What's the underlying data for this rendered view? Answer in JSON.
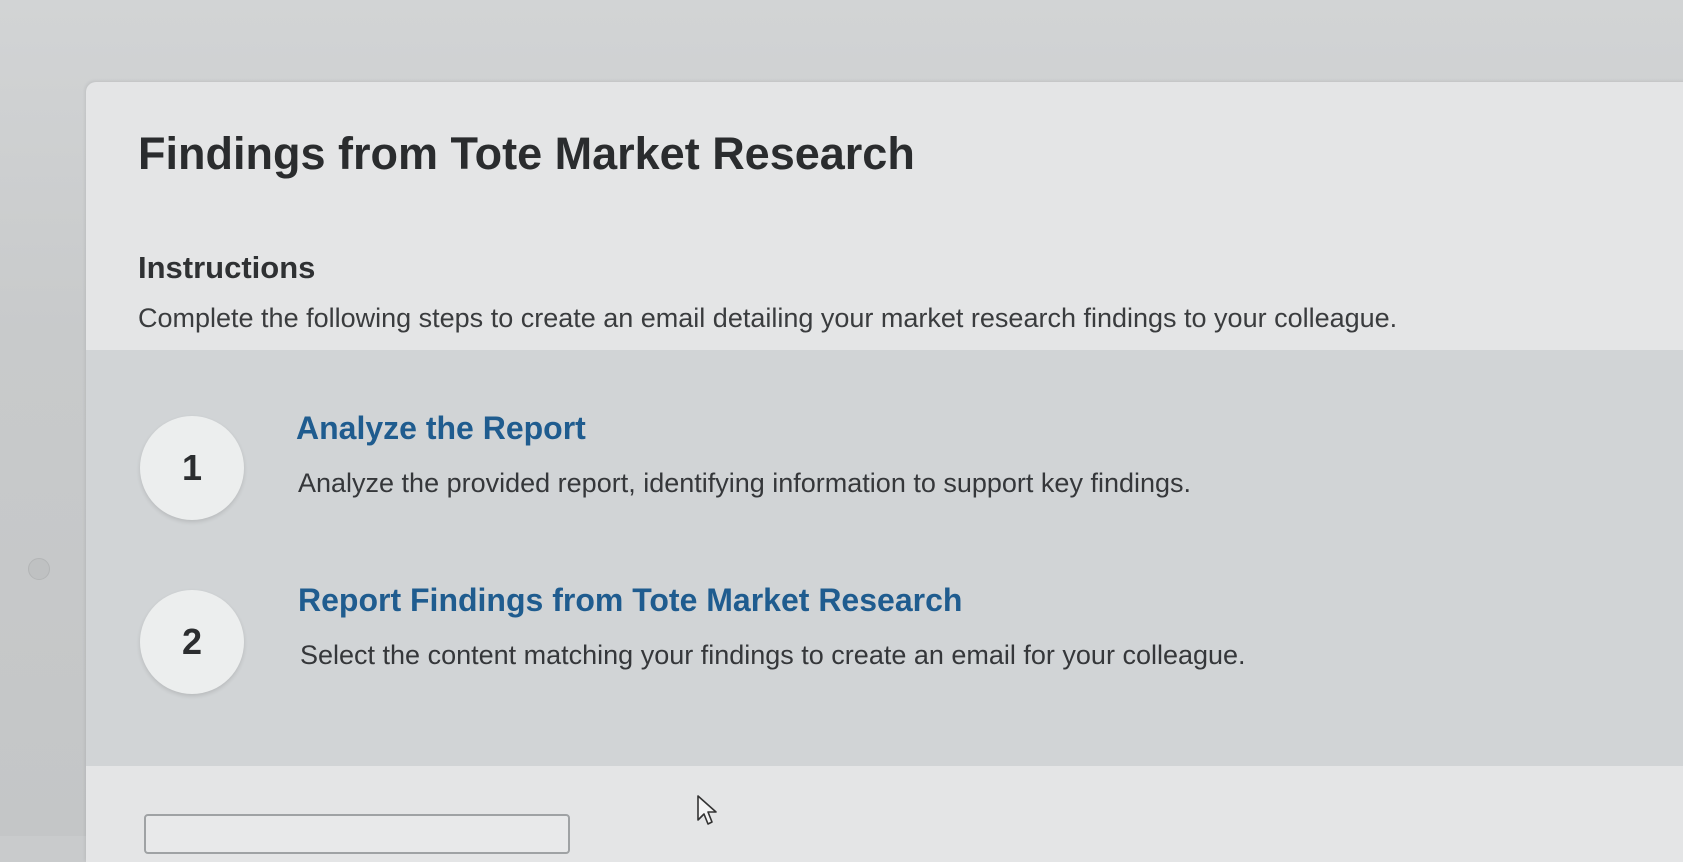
{
  "page": {
    "title": "Findings from Tote Market Research"
  },
  "instructions": {
    "heading": "Instructions",
    "text": "Complete the following steps to create an email detailing your market research findings to your colleague."
  },
  "steps": [
    {
      "number": "1",
      "title": "Analyze the Report",
      "description": "Analyze the provided report, identifying information to support key findings."
    },
    {
      "number": "2",
      "title": "Report Findings from Tote Market Research",
      "description": "Select the content matching your findings to create an email for your colleague."
    }
  ],
  "colors": {
    "step_title": "#1f5c8f",
    "text": "#2a2c2e"
  },
  "icons": {
    "cursor": "mouse-pointer-icon"
  }
}
